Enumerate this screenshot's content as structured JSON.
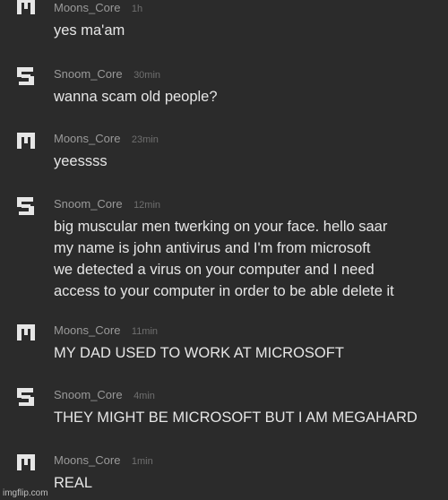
{
  "messages": [
    {
      "user": "Moons_Core",
      "avatar": "moons-avatar-icon",
      "time": "1h",
      "lines": [
        "yes ma'am"
      ]
    },
    {
      "user": "Snoom_Core",
      "avatar": "snoom-avatar-icon",
      "time": "30min",
      "lines": [
        "wanna scam old people?"
      ]
    },
    {
      "user": "Moons_Core",
      "avatar": "moons-avatar-icon",
      "time": "23min",
      "lines": [
        "yeessss"
      ]
    },
    {
      "user": "Snoom_Core",
      "avatar": "snoom-avatar-icon",
      "time": "12min",
      "lines": [
        "big muscular men twerking on your face. hello saar",
        "my name is john antivirus and I'm from microsoft",
        "we detected a virus on your computer and I need",
        "access to your computer in order to be able delete it"
      ]
    },
    {
      "user": "Moons_Core",
      "avatar": "moons-avatar-icon",
      "time": "11min",
      "lines": [
        "MY DAD USED TO WORK AT MICROSOFT"
      ]
    },
    {
      "user": "Snoom_Core",
      "avatar": "snoom-avatar-icon",
      "time": "4min",
      "lines": [
        "THEY MIGHT BE MICROSOFT BUT I AM MEGAHARD"
      ]
    },
    {
      "user": "Moons_Core",
      "avatar": "moons-avatar-icon",
      "time": "1min",
      "lines": [
        "REAL"
      ]
    }
  ],
  "watermark": "imgflip.com",
  "colors": {
    "background": "#2b2b2b",
    "username": "#9a9a9a",
    "time": "#6f6f6f",
    "text": "#e6e6e6"
  }
}
